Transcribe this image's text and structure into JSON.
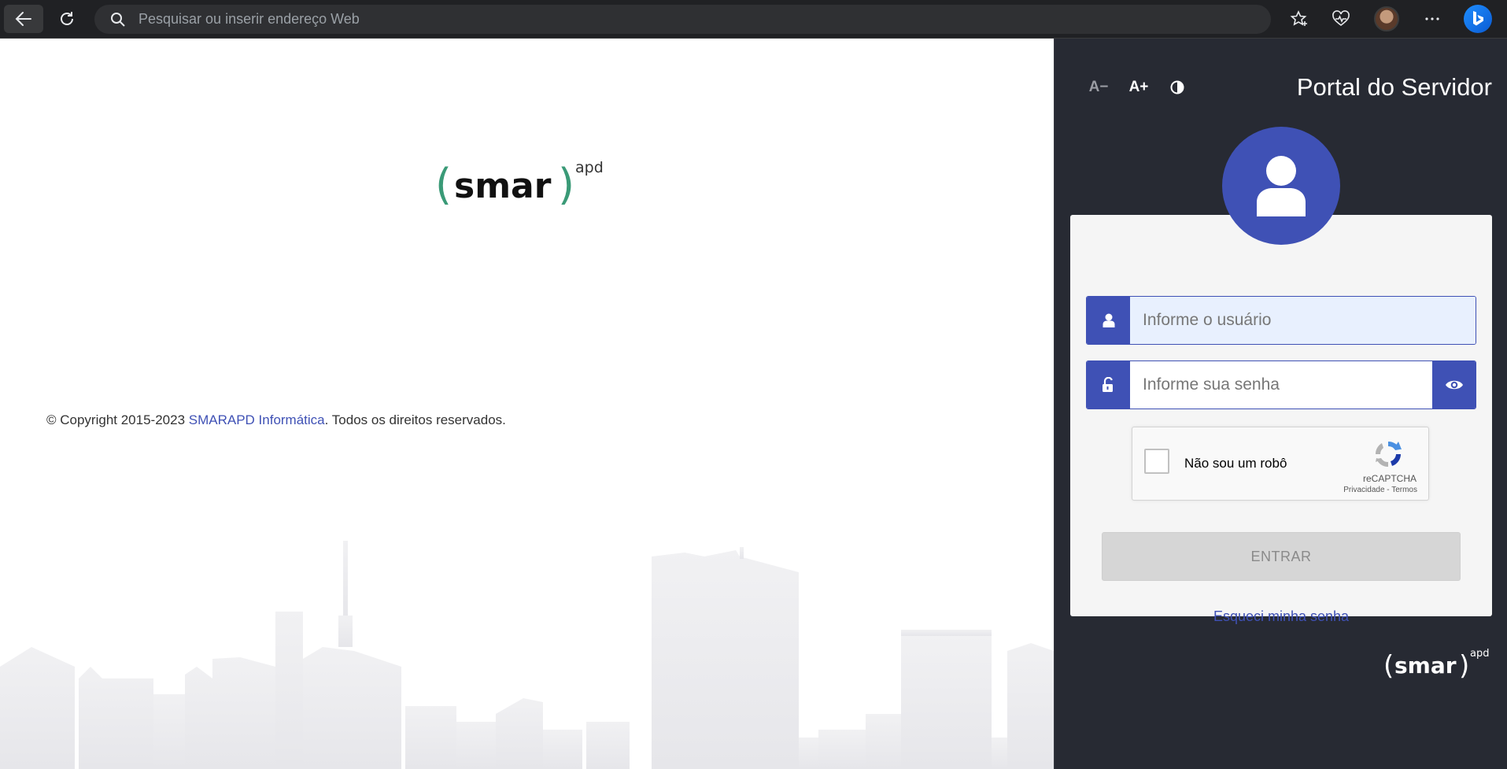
{
  "browser": {
    "address_placeholder": "Pesquisar ou inserir endereço Web"
  },
  "brand": {
    "logo_text": "smar",
    "logo_suffix": "apd",
    "logo_accent_color": "#3a9a77"
  },
  "footer": {
    "copyright_prefix": "© Copyright 2015-2023 ",
    "company_link": "SMARAPD Informática",
    "copyright_suffix": ". Todos os direitos reservados."
  },
  "accessibility": {
    "font_decrease": "A−",
    "font_increase": "A+"
  },
  "login": {
    "portal_title": "Portal do Servidor",
    "username_placeholder": "Informe o usuário",
    "password_placeholder": "Informe sua senha",
    "captcha_label": "Não sou um robô",
    "captcha_brand": "reCAPTCHA",
    "captcha_links": "Privacidade - Termos",
    "submit_label": "ENTRAR",
    "forgot_password": "Esqueci minha senha"
  },
  "colors": {
    "primary": "#3f51b5",
    "panel_bg": "#272a33",
    "card_bg": "#f5f5f5"
  }
}
